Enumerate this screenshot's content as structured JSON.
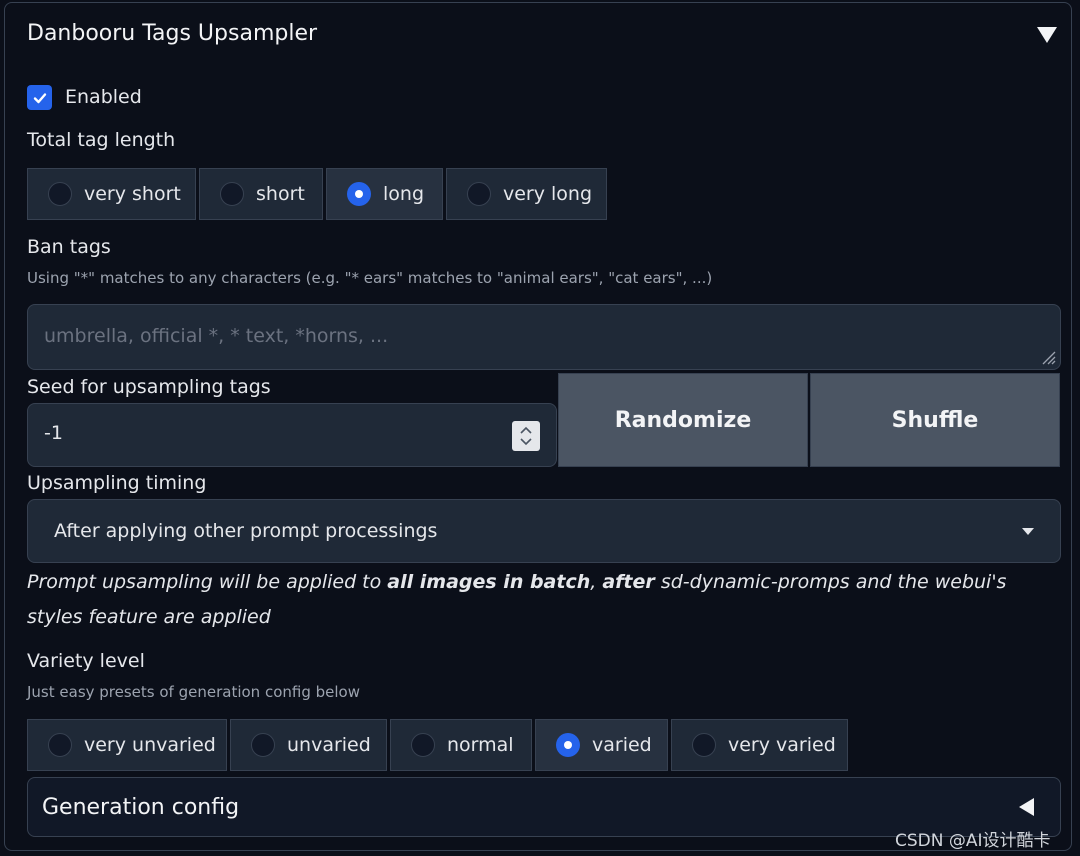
{
  "panel": {
    "title": "Danbooru Tags Upsampler",
    "enabled_label": "Enabled",
    "enabled": true
  },
  "total_tag_length": {
    "label": "Total tag length",
    "options": [
      "very short",
      "short",
      "long",
      "very long"
    ],
    "selected": "long"
  },
  "ban_tags": {
    "label": "Ban tags",
    "hint": "Using \"*\" matches to any characters (e.g. \"* ears\" matches to \"animal ears\", \"cat ears\", ...)",
    "placeholder": "umbrella, official *, * text, *horns, ..."
  },
  "seed": {
    "label": "Seed for upsampling tags",
    "value": "-1",
    "randomize_label": "Randomize",
    "shuffle_label": "Shuffle"
  },
  "timing": {
    "label": "Upsampling timing",
    "selected": "After applying other prompt processings",
    "info_part1": "Prompt upsampling will be applied to ",
    "info_bold1": "all images in batch",
    "info_part2": ", ",
    "info_bold2": "after",
    "info_part3": " sd-dynamic-promps and the webui's styles feature are applied"
  },
  "variety": {
    "label": "Variety level",
    "hint": "Just easy presets of generation config below",
    "options": [
      "very unvaried",
      "unvaried",
      "normal",
      "varied",
      "very varied"
    ],
    "selected": "varied"
  },
  "generation_config": {
    "label": "Generation config"
  },
  "watermark": "CSDN @AI设计酷卡",
  "colors": {
    "background": "#0b0f19",
    "accent": "#2563eb",
    "input_bg": "#1f2937",
    "button_bg": "#4b5563"
  }
}
